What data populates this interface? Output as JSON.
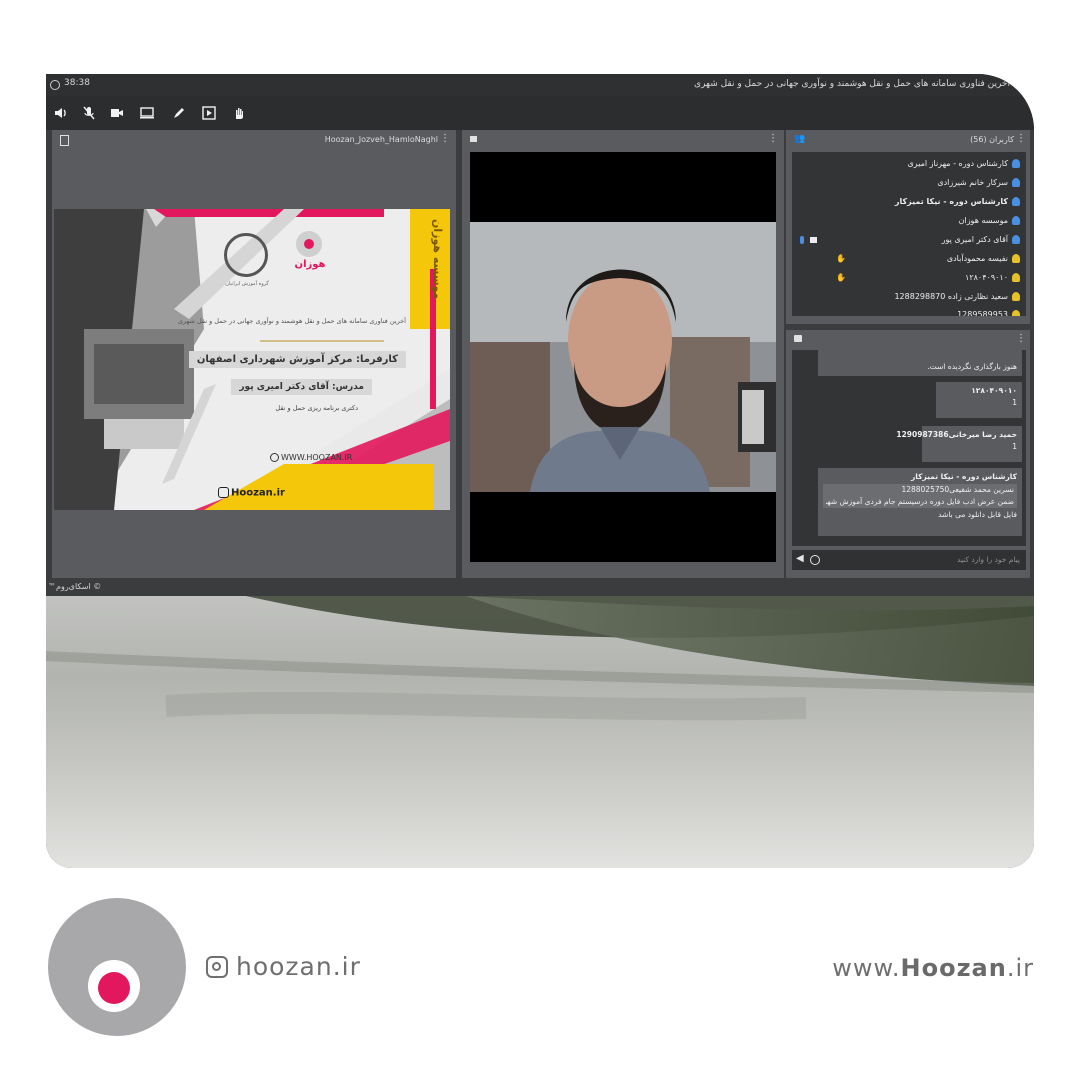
{
  "topbar": {
    "time": "38:38",
    "title": "آخرین فناوری سامانه های حمل و نقل هوشمند و نوآوری جهانی در حمل و نقل شهری"
  },
  "toolbar": {
    "icons": [
      "speaker-icon",
      "mic-muted-icon",
      "camera-icon",
      "screen-share-icon",
      "pen-icon",
      "play-icon",
      "raise-hand-icon"
    ]
  },
  "presentation": {
    "filename": "Hoozan_Jozveh_HamloNaghl",
    "slide": {
      "vertical_brand": "موسسه هوزان",
      "subtitle": "آخرین فناوری سامانه های حمل و نقل هوشمند و نوآوری جهانی در حمل و نقل شهری",
      "client": "کارفرما: مرکز آموزش شهرداری اصفهان",
      "instructor": "مدرس: آقای دکتر امیری پور",
      "degree": "دکتری برنامه ریزی حمل و نقل",
      "website": "WWW.HOOZAN.IR",
      "instagram": "Hoozan.ir",
      "logo_text": "هوزان",
      "small_logo_caption": "گروه آموزش ایرانیان"
    }
  },
  "users": {
    "header": "کاربران (56)",
    "items": [
      {
        "name": "کارشناس دوره - مهرناز امیری",
        "bold": false,
        "color": "#4a90e2"
      },
      {
        "name": "سرکار خانم شیرزادی",
        "bold": false,
        "color": "#4a90e2"
      },
      {
        "name": "کارشناس دوره - نیکا تمیزکار",
        "bold": true,
        "color": "#4a90e2"
      },
      {
        "name": "موسسه هوزان",
        "bold": false,
        "color": "#4a90e2"
      },
      {
        "name": "آقای دکتر امیری پور",
        "bold": false,
        "color": "#4a90e2"
      },
      {
        "name": "نفیسه محمودآبادی",
        "bold": false,
        "color": "#e6c229"
      },
      {
        "name": "۱۲۸۰۴۰۹۰۱۰",
        "bold": false,
        "color": "#e6c229"
      },
      {
        "name": "سعید نظارتی زاده 1288298870",
        "bold": false,
        "color": "#e6c229"
      },
      {
        "name": "1289589953",
        "bold": false,
        "color": "#e6c229"
      }
    ]
  },
  "chat": {
    "messages": [
      {
        "author": "",
        "text": "هنوز بارگذاری نگردیده است."
      },
      {
        "author": "۱۲۸۰۴۰۹۰۱۰",
        "text": "1"
      },
      {
        "author": "حمید رضا میرخانی1290987386",
        "text": "1"
      },
      {
        "author": "کارشناس دوره - نیکا تمیزکار",
        "quote": "نسرین محمد شفیعی1288025750",
        "quote_text": "ضمن عرض ادب فایل دوره درسیستم جام فردی آموزش شهردار...",
        "text": "فایل قابل دانلود می باشد"
      }
    ],
    "input_placeholder": "پیام خود را وارد کنید"
  },
  "footer": {
    "copyright": "© اسکای‌روم™"
  },
  "branding": {
    "instagram_handle": "hoozan.ir",
    "website_prefix": "www.",
    "website_name": "Hoozan",
    "website_suffix": ".ir",
    "accent": "#e3175d"
  }
}
